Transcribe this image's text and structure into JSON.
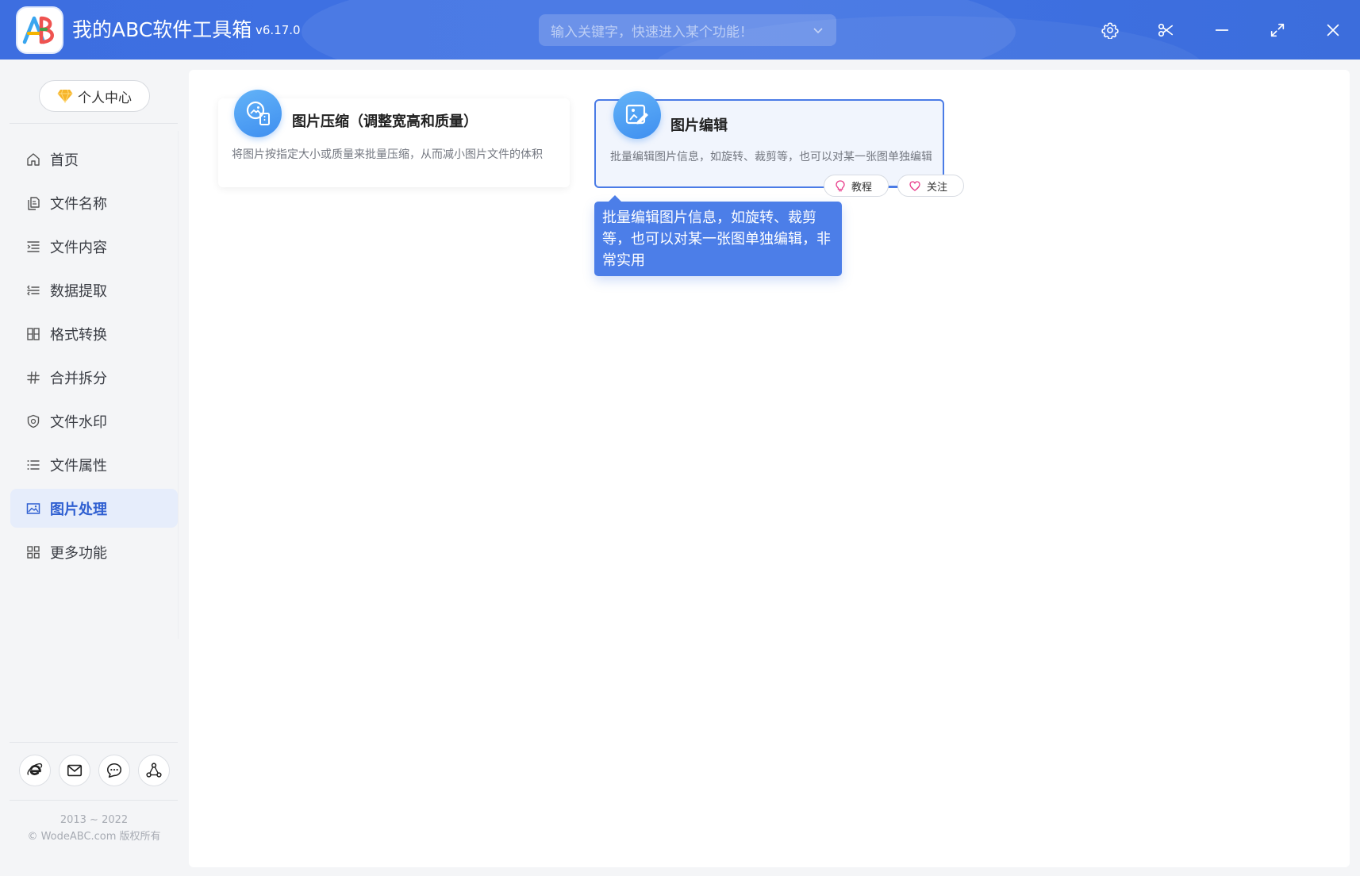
{
  "app": {
    "logo_text": "AB",
    "title": "我的ABC软件工具箱",
    "version": "v6.17.0"
  },
  "search": {
    "placeholder": "输入关键字，快速进入某个功能！"
  },
  "window_controls": [
    "settings-icon",
    "scissors-icon",
    "minimize-icon",
    "maximize-icon",
    "close-icon"
  ],
  "sidebar": {
    "personal_center": "个人中心",
    "items": [
      {
        "label": "首页",
        "icon": "home-icon",
        "active": false
      },
      {
        "label": "文件名称",
        "icon": "file-copy-icon",
        "active": false
      },
      {
        "label": "文件内容",
        "icon": "indent-list-icon",
        "active": false
      },
      {
        "label": "数据提取",
        "icon": "extract-arrows-icon",
        "active": false
      },
      {
        "label": "格式转换",
        "icon": "convert-grid-icon",
        "active": false
      },
      {
        "label": "合并拆分",
        "icon": "hash-icon",
        "active": false
      },
      {
        "label": "文件水印",
        "icon": "shield-icon",
        "active": false
      },
      {
        "label": "文件属性",
        "icon": "list-icon",
        "active": false
      },
      {
        "label": "图片处理",
        "icon": "image-icon",
        "active": true
      },
      {
        "label": "更多功能",
        "icon": "apps-grid-icon",
        "active": false
      }
    ],
    "bottom_icons": [
      "ie-browser-icon",
      "mail-icon",
      "chat-bubble-icon",
      "share-nodes-icon"
    ],
    "copyright_years": "2013 ~ 2022",
    "copyright_text": "© WodeABC.com 版权所有"
  },
  "cards": [
    {
      "title": "图片压缩（调整宽高和质量）",
      "description": "将图片按指定大小或质量来批量压缩，从而减小图片文件的体积",
      "icon": "image-compress-icon",
      "selected": false
    },
    {
      "title": "图片编辑",
      "description": "批量编辑图片信息，如旋转、裁剪等，也可以对某一张图单独编辑",
      "icon": "image-edit-icon",
      "selected": true
    }
  ],
  "card_actions": {
    "tutorial": "教程",
    "follow": "关注"
  },
  "tooltip": {
    "text": "批量编辑图片信息，如旋转、裁剪等，也可以对某一张图单独编辑，非常实用"
  },
  "colors": {
    "titlebar": "#3e6fe2",
    "accent": "#4a7be6",
    "active_nav_bg": "#e6edfb",
    "tooltip_bg": "#4c7ee8"
  }
}
